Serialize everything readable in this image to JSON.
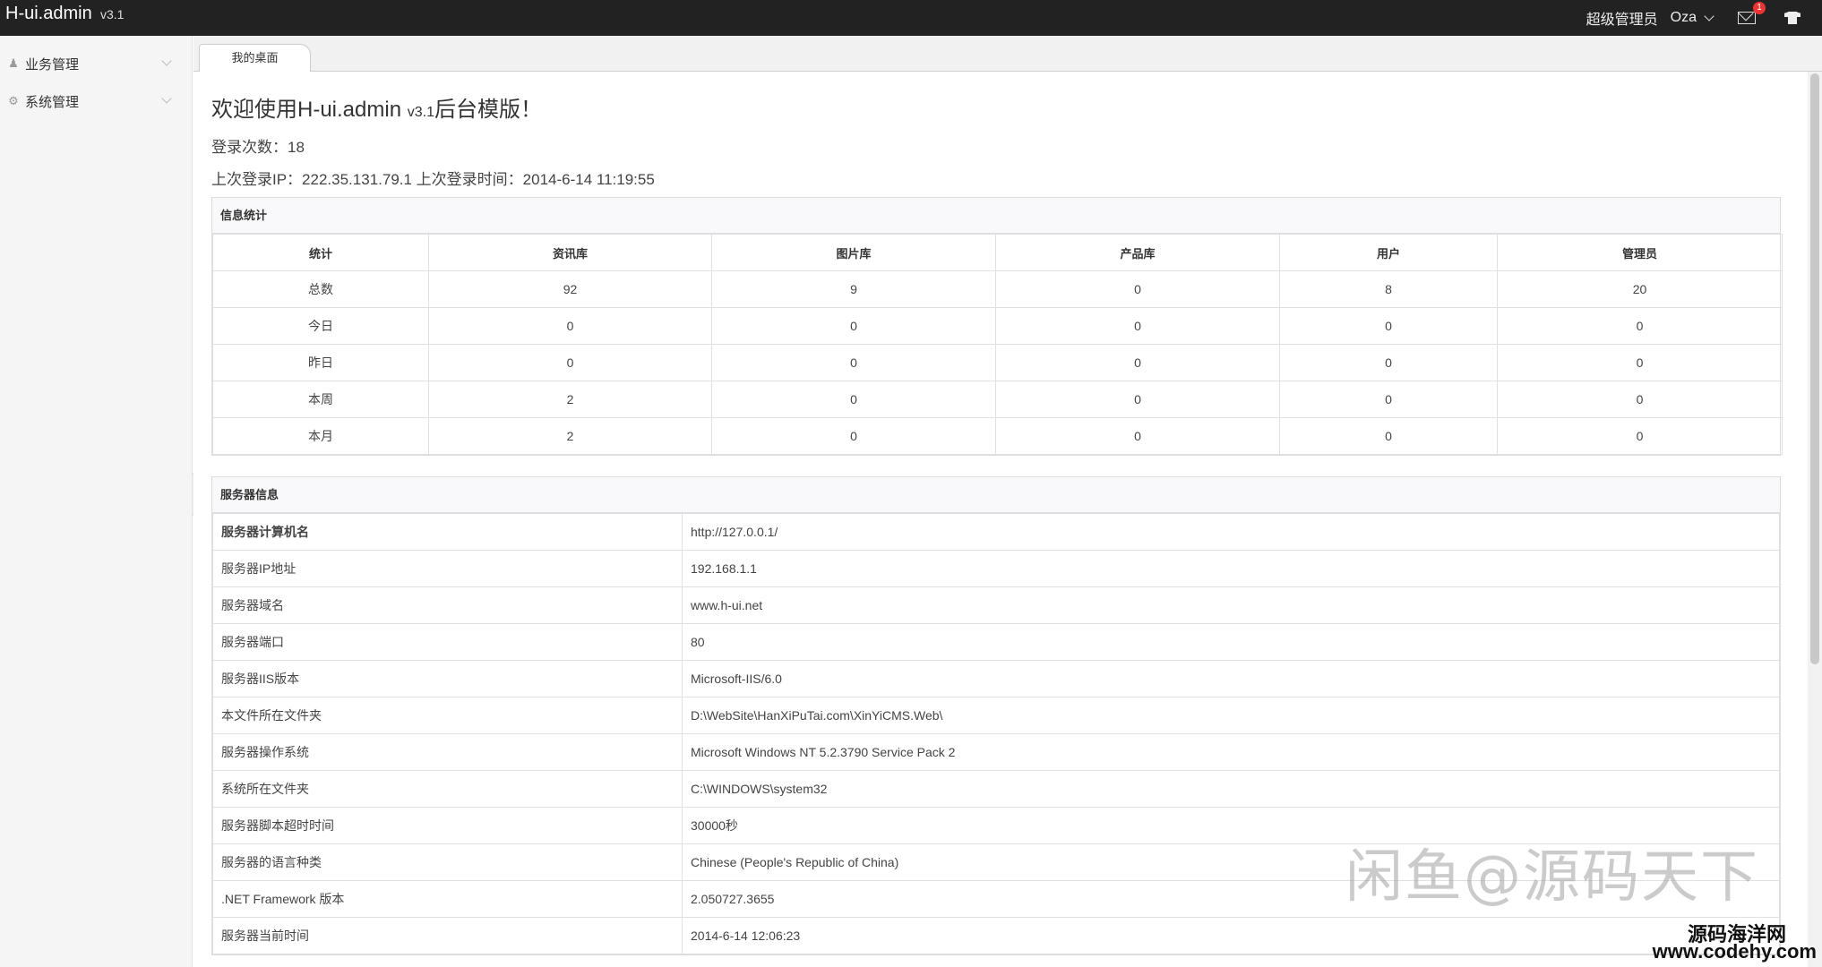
{
  "topbar": {
    "logo": "H-ui.admin",
    "version": "v3.1",
    "role": "超级管理员",
    "user": "Oza",
    "mail_badge": "1"
  },
  "sidebar": {
    "items": [
      {
        "label": "业务管理",
        "icon": "user-icon"
      },
      {
        "label": "系统管理",
        "icon": "gear-icon"
      }
    ]
  },
  "tabs": [
    {
      "label": "我的桌面"
    }
  ],
  "welcome": {
    "title_prefix": "欢迎使用H-ui.admin ",
    "title_version": "v3.1",
    "title_suffix": "后台模版！",
    "login_count": "登录次数：18",
    "last_login": "上次登录IP：222.35.131.79.1 上次登录时间：2014-6-14 11:19:55"
  },
  "stats": {
    "title": "信息统计",
    "headers": [
      "统计",
      "资讯库",
      "图片库",
      "产品库",
      "用户",
      "管理员"
    ],
    "rows": [
      [
        "总数",
        "92",
        "9",
        "0",
        "8",
        "20"
      ],
      [
        "今日",
        "0",
        "0",
        "0",
        "0",
        "0"
      ],
      [
        "昨日",
        "0",
        "0",
        "0",
        "0",
        "0"
      ],
      [
        "本周",
        "2",
        "0",
        "0",
        "0",
        "0"
      ],
      [
        "本月",
        "2",
        "0",
        "0",
        "0",
        "0"
      ]
    ]
  },
  "server": {
    "title": "服务器信息",
    "rows": [
      [
        "服务器计算机名",
        "http://127.0.0.1/"
      ],
      [
        "服务器IP地址",
        "192.168.1.1"
      ],
      [
        "服务器域名",
        "www.h-ui.net"
      ],
      [
        "服务器端口",
        "80"
      ],
      [
        "服务器IIS版本",
        "Microsoft-IIS/6.0"
      ],
      [
        "本文件所在文件夹",
        "D:\\WebSite\\HanXiPuTai.com\\XinYiCMS.Web\\"
      ],
      [
        "服务器操作系统",
        "Microsoft Windows NT 5.2.3790 Service Pack 2"
      ],
      [
        "系统所在文件夹",
        "C:\\WINDOWS\\system32"
      ],
      [
        "服务器脚本超时时间",
        "30000秒"
      ],
      [
        "服务器的语言种类",
        "Chinese (People's Republic of China)"
      ],
      [
        ".NET Framework 版本",
        "2.050727.3655"
      ],
      [
        "服务器当前时间",
        "2014-6-14 12:06:23"
      ]
    ]
  },
  "watermark": {
    "main": "闲鱼@源码天下",
    "site_name": "源码海洋网",
    "site_url": "www.codehy.com"
  }
}
